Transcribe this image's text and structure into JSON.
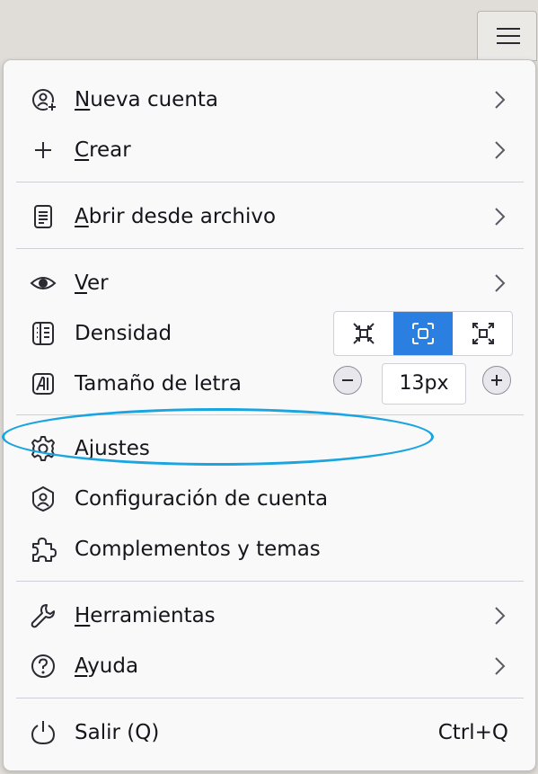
{
  "toolbar": {
    "menu_button_icon": "hamburger-icon"
  },
  "menu": {
    "items": [
      {
        "label_u": "N",
        "label_rest": "ueva cuenta",
        "icon": "new-account-icon",
        "has_submenu": true
      },
      {
        "label_u": "C",
        "label_rest": "rear",
        "icon": "plus-icon",
        "has_submenu": true
      },
      {
        "label_u": "A",
        "label_rest": "brir desde archivo",
        "icon": "document-icon",
        "has_submenu": true
      },
      {
        "label_u": "V",
        "label_rest": "er",
        "icon": "eye-icon",
        "has_submenu": true
      },
      {
        "label": "Densidad",
        "icon": "density-icon"
      },
      {
        "label": "Tamaño de letra",
        "icon": "font-size-icon"
      },
      {
        "label": "Ajustes",
        "icon": "gear-icon"
      },
      {
        "label": "Configuración de cuenta",
        "icon": "account-shield-icon"
      },
      {
        "label": "Complementos y temas",
        "icon": "puzzle-icon"
      },
      {
        "label_u": "H",
        "label_rest": "erramientas",
        "icon": "wrench-icon",
        "has_submenu": true
      },
      {
        "label_u": "A",
        "label_rest": "yuda",
        "icon": "help-icon",
        "has_submenu": true
      },
      {
        "label": "Salir (Q)",
        "icon": "power-icon",
        "shortcut": "Ctrl+Q"
      }
    ],
    "density": {
      "options": [
        "compact",
        "normal",
        "relaxed"
      ],
      "selected": "normal"
    },
    "font_size": {
      "value": "13px"
    }
  },
  "colors": {
    "accent": "#2a7fe0",
    "highlight": "#1aa4e0",
    "text": "#15141a"
  }
}
